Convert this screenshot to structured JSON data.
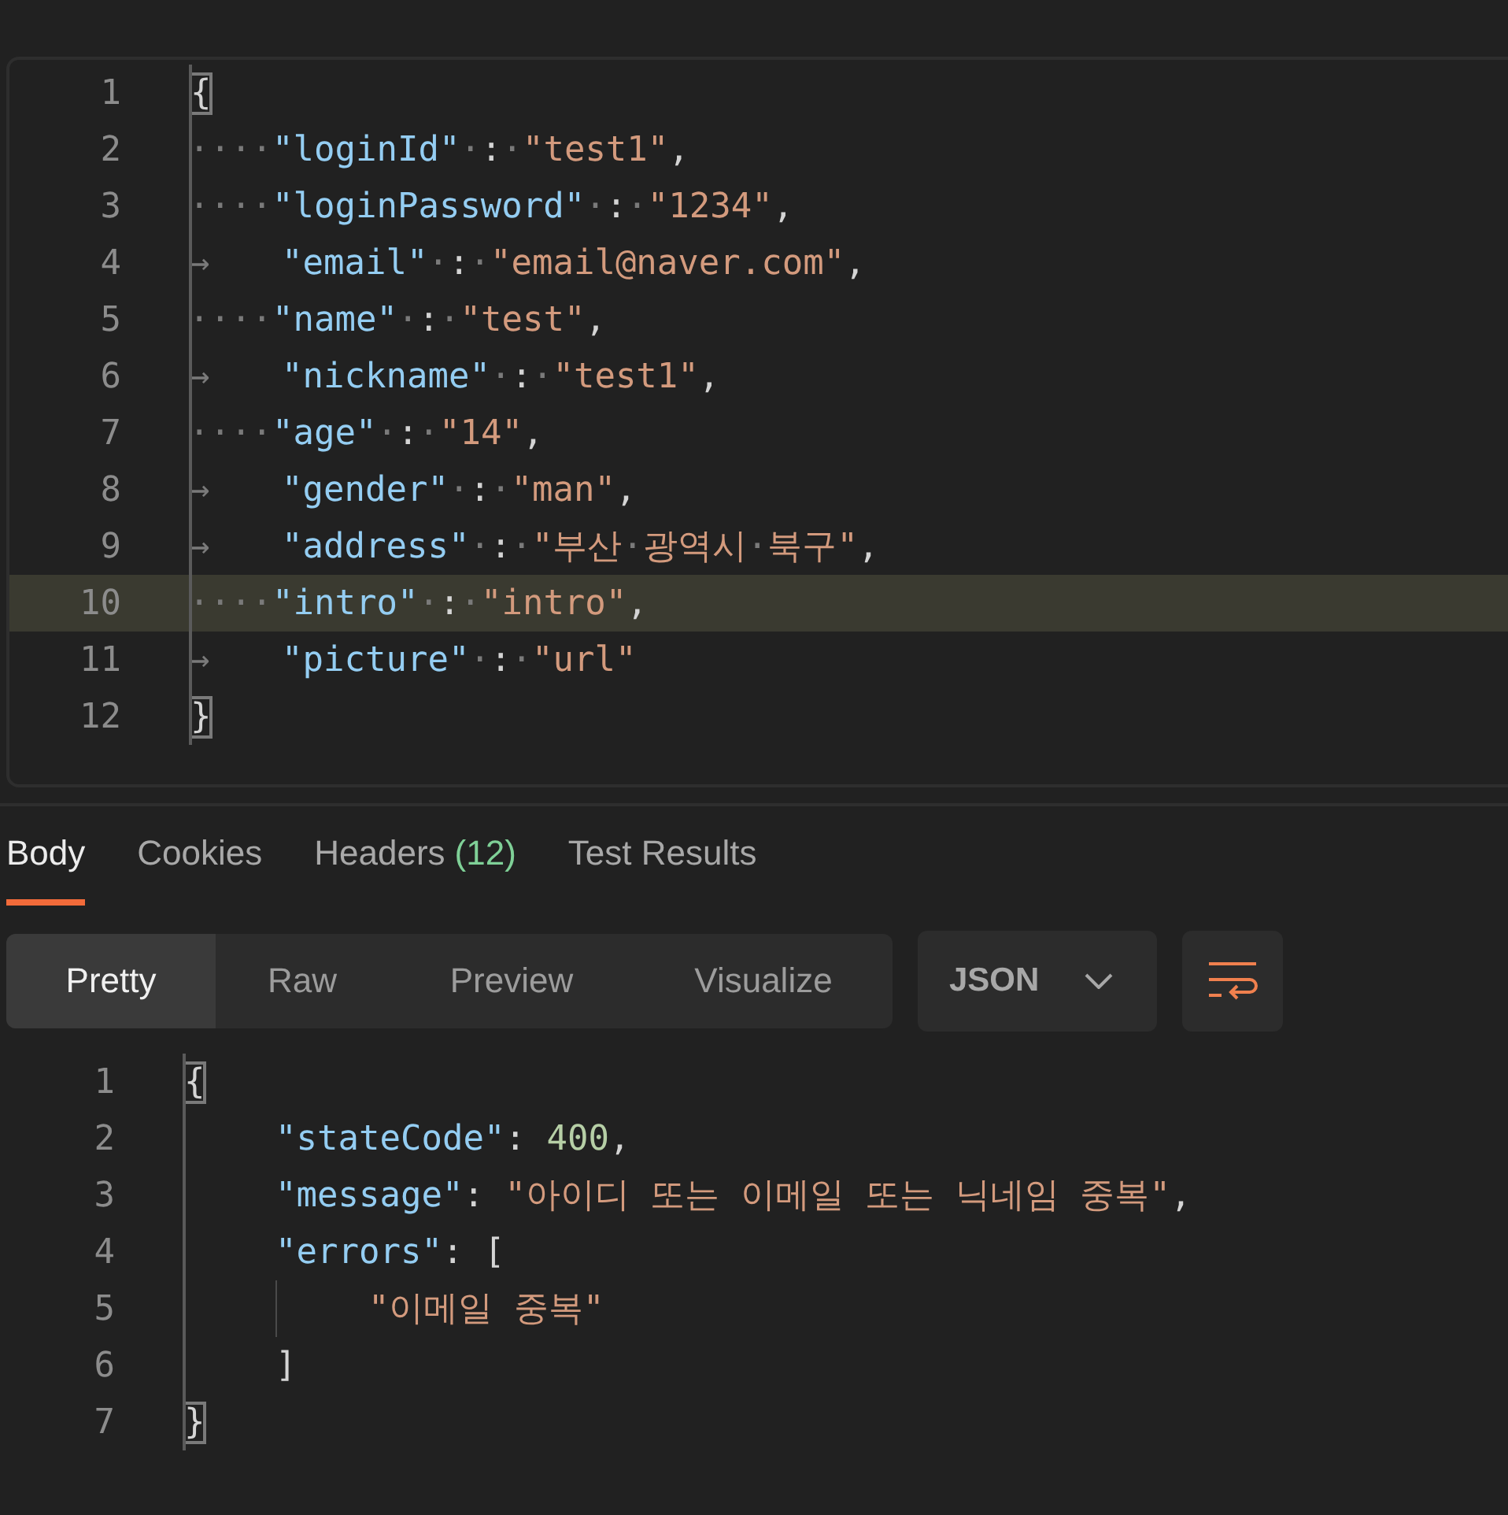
{
  "request_editor": {
    "lines": [
      {
        "number": "1",
        "selected": false,
        "tokens": [
          {
            "kind": "brace",
            "text": "{"
          }
        ]
      },
      {
        "number": "2",
        "selected": false,
        "tokens": [
          {
            "kind": "ws",
            "text": "····"
          },
          {
            "kind": "key",
            "text": "\"loginId\""
          },
          {
            "kind": "ws",
            "text": "·"
          },
          {
            "kind": "punct",
            "text": ":"
          },
          {
            "kind": "ws",
            "text": "·"
          },
          {
            "kind": "string",
            "text": "\"test1\""
          },
          {
            "kind": "punct",
            "text": ","
          }
        ]
      },
      {
        "number": "3",
        "selected": false,
        "tokens": [
          {
            "kind": "ws",
            "text": "····"
          },
          {
            "kind": "key",
            "text": "\"loginPassword\""
          },
          {
            "kind": "ws",
            "text": "·"
          },
          {
            "kind": "punct",
            "text": ":"
          },
          {
            "kind": "ws",
            "text": "·"
          },
          {
            "kind": "string",
            "text": "\"1234\""
          },
          {
            "kind": "punct",
            "text": ","
          }
        ]
      },
      {
        "number": "4",
        "selected": false,
        "tokens": [
          {
            "kind": "tab",
            "text": "→"
          },
          {
            "kind": "key",
            "text": "\"email\""
          },
          {
            "kind": "ws",
            "text": "·"
          },
          {
            "kind": "punct",
            "text": ":"
          },
          {
            "kind": "ws",
            "text": "·"
          },
          {
            "kind": "string",
            "text": "\"email@naver.com\""
          },
          {
            "kind": "punct",
            "text": ","
          }
        ]
      },
      {
        "number": "5",
        "selected": false,
        "tokens": [
          {
            "kind": "ws",
            "text": "····"
          },
          {
            "kind": "key",
            "text": "\"name\""
          },
          {
            "kind": "ws",
            "text": "·"
          },
          {
            "kind": "punct",
            "text": ":"
          },
          {
            "kind": "ws",
            "text": "·"
          },
          {
            "kind": "string",
            "text": "\"test\""
          },
          {
            "kind": "punct",
            "text": ","
          }
        ]
      },
      {
        "number": "6",
        "selected": false,
        "tokens": [
          {
            "kind": "tab",
            "text": "→"
          },
          {
            "kind": "key",
            "text": "\"nickname\""
          },
          {
            "kind": "ws",
            "text": "·"
          },
          {
            "kind": "punct",
            "text": ":"
          },
          {
            "kind": "ws",
            "text": "·"
          },
          {
            "kind": "string",
            "text": "\"test1\""
          },
          {
            "kind": "punct",
            "text": ","
          }
        ]
      },
      {
        "number": "7",
        "selected": false,
        "tokens": [
          {
            "kind": "ws",
            "text": "····"
          },
          {
            "kind": "key",
            "text": "\"age\""
          },
          {
            "kind": "ws",
            "text": "·"
          },
          {
            "kind": "punct",
            "text": ":"
          },
          {
            "kind": "ws",
            "text": "·"
          },
          {
            "kind": "string",
            "text": "\"14\""
          },
          {
            "kind": "punct",
            "text": ","
          }
        ]
      },
      {
        "number": "8",
        "selected": false,
        "tokens": [
          {
            "kind": "tab",
            "text": "→"
          },
          {
            "kind": "key",
            "text": "\"gender\""
          },
          {
            "kind": "ws",
            "text": "·"
          },
          {
            "kind": "punct",
            "text": ":"
          },
          {
            "kind": "ws",
            "text": "·"
          },
          {
            "kind": "string",
            "text": "\"man\""
          },
          {
            "kind": "punct",
            "text": ","
          }
        ]
      },
      {
        "number": "9",
        "selected": false,
        "tokens": [
          {
            "kind": "tab",
            "text": "→"
          },
          {
            "kind": "key",
            "text": "\"address\""
          },
          {
            "kind": "ws",
            "text": "·"
          },
          {
            "kind": "punct",
            "text": ":"
          },
          {
            "kind": "ws",
            "text": "·"
          },
          {
            "kind": "string",
            "text": "\"부산"
          },
          {
            "kind": "ws",
            "text": "·"
          },
          {
            "kind": "string",
            "text": "광역시"
          },
          {
            "kind": "ws",
            "text": "·"
          },
          {
            "kind": "string",
            "text": "북구\""
          },
          {
            "kind": "punct",
            "text": ","
          }
        ]
      },
      {
        "number": "10",
        "selected": true,
        "tokens": [
          {
            "kind": "ws",
            "text": "····"
          },
          {
            "kind": "key",
            "text": "\"intro\""
          },
          {
            "kind": "ws",
            "text": "·"
          },
          {
            "kind": "punct",
            "text": ":"
          },
          {
            "kind": "ws",
            "text": "·"
          },
          {
            "kind": "string",
            "text": "\"intro\""
          },
          {
            "kind": "punct",
            "text": ","
          }
        ]
      },
      {
        "number": "11",
        "selected": false,
        "tokens": [
          {
            "kind": "tab",
            "text": "→"
          },
          {
            "kind": "key",
            "text": "\"picture\""
          },
          {
            "kind": "ws",
            "text": "·"
          },
          {
            "kind": "punct",
            "text": ":"
          },
          {
            "kind": "ws",
            "text": "·"
          },
          {
            "kind": "string",
            "text": "\"url\""
          }
        ]
      },
      {
        "number": "12",
        "selected": false,
        "tokens": [
          {
            "kind": "brace",
            "text": "}"
          }
        ]
      }
    ]
  },
  "response_tabs": [
    {
      "label": "Body",
      "selected": true
    },
    {
      "label": "Cookies",
      "selected": false
    },
    {
      "label": "Headers",
      "count": "(12)",
      "selected": false
    },
    {
      "label": "Test Results",
      "selected": false
    }
  ],
  "view_modes": [
    {
      "label": "Pretty",
      "selected": true
    },
    {
      "label": "Raw",
      "selected": false
    },
    {
      "label": "Preview",
      "selected": false
    },
    {
      "label": "Visualize",
      "selected": false
    }
  ],
  "format_dropdown": {
    "value": "JSON"
  },
  "wrap_button": {
    "on": true
  },
  "response_editor": {
    "lines": [
      {
        "number": "1",
        "selected": false,
        "tokens": [
          {
            "kind": "brace",
            "text": "{"
          }
        ]
      },
      {
        "number": "2",
        "selected": false,
        "tokens": [
          {
            "kind": "indent"
          },
          {
            "kind": "key",
            "text": "\"stateCode\""
          },
          {
            "kind": "punct",
            "text": ": "
          },
          {
            "kind": "number",
            "text": "400"
          },
          {
            "kind": "punct",
            "text": ","
          }
        ]
      },
      {
        "number": "3",
        "selected": false,
        "tokens": [
          {
            "kind": "indent"
          },
          {
            "kind": "key",
            "text": "\"message\""
          },
          {
            "kind": "punct",
            "text": ": "
          },
          {
            "kind": "string",
            "text": "\"아이디 또는 이메일 또는 닉네임 중복\""
          },
          {
            "kind": "punct",
            "text": ","
          }
        ]
      },
      {
        "number": "4",
        "selected": false,
        "tokens": [
          {
            "kind": "indent"
          },
          {
            "kind": "key",
            "text": "\"errors\""
          },
          {
            "kind": "punct",
            "text": ": ["
          }
        ]
      },
      {
        "number": "5",
        "selected": false,
        "tokens": [
          {
            "kind": "indent"
          },
          {
            "kind": "guide"
          },
          {
            "kind": "string",
            "text": "\"이메일 중복\""
          }
        ]
      },
      {
        "number": "6",
        "selected": false,
        "tokens": [
          {
            "kind": "indent"
          },
          {
            "kind": "punct",
            "text": "]"
          }
        ]
      },
      {
        "number": "7",
        "selected": false,
        "tokens": [
          {
            "kind": "brace",
            "text": "}"
          }
        ]
      }
    ]
  }
}
